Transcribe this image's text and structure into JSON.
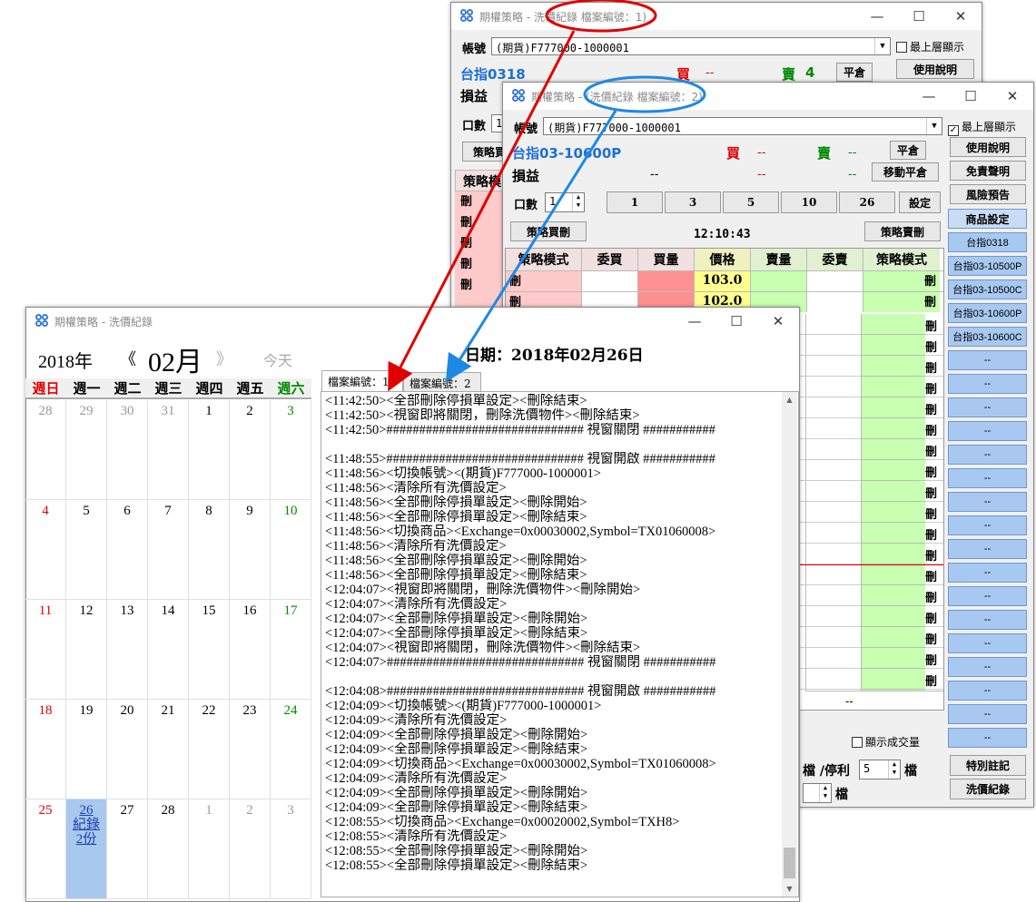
{
  "win1": {
    "title": "期權策略 - 洗價紀錄 檔案編號：1)",
    "account_label": "帳號",
    "account_value": "(期貨)F777000-1000001",
    "topmost_label": "最上層顯示",
    "product": "台指0318",
    "buy_label": "買",
    "buy_value": "--",
    "sell_label": "賣",
    "sell_value": "4",
    "flatten": "平倉",
    "manual": "使用說明",
    "pnl_label": "損益",
    "qty_label": "口數",
    "qty_value": "1",
    "strategy_buy_partial": "策略買",
    "strategy_mode_partial": "策略模",
    "delete_glyph": "刪"
  },
  "win2": {
    "title": "期權策略 - (洗價紀錄 檔案編號：2)",
    "account_label": "帳號",
    "account_value": "(期貨)F777000-1000001",
    "topmost_label": "最上層顯示",
    "product": "台指03-10600P",
    "buy_label": "買",
    "buy_value": "--",
    "sell_label": "賣",
    "sell_value": "--",
    "flatten": "平倉",
    "move_flatten": "移動平倉",
    "pnl_label": "損益",
    "pnl_a": "--",
    "pnl_b": "--",
    "pnl_c": "--",
    "qty_label": "口數",
    "qty_value": "1",
    "qty_buttons": [
      "1",
      "3",
      "5",
      "10",
      "26"
    ],
    "set": "設定",
    "strategy_buy": "策略買刪",
    "time": "12:10:43",
    "strategy_sell": "策略賣刪",
    "headers": [
      "策略模式",
      "委買",
      "買量",
      "價格",
      "賣量",
      "委賣",
      "策略模式"
    ],
    "prices": [
      "103.0",
      "102.0"
    ],
    "delete_glyph": "刪",
    "footer_dash": "--",
    "show_fill_label": "顯示成交量",
    "stop_label": "檔 /停利",
    "stop_value": "5",
    "tick_label": "檔",
    "tick_label2": "檔",
    "side_buttons": [
      "使用說明",
      "免責聲明",
      "風險預告"
    ],
    "product_settings": "商品設定",
    "products": [
      "台指0318",
      "台指03-10500P",
      "台指03-10500C",
      "台指03-10600P",
      "台指03-10600C"
    ],
    "empty_slot": "--",
    "special_note": "特別註記",
    "price_log": "洗價紀錄"
  },
  "win3": {
    "title": "期權策略 - 洗價紀錄",
    "year": "2018年",
    "prev": "《",
    "month": "02月",
    "next": "》",
    "today": "今天",
    "date_label": "日期：2018年02月26日",
    "weekdays": [
      "週日",
      "週一",
      "週二",
      "週三",
      "週四",
      "週五",
      "週六"
    ],
    "days": [
      [
        "28",
        "29",
        "30",
        "31",
        "1",
        "2",
        "3"
      ],
      [
        "4",
        "5",
        "6",
        "7",
        "8",
        "9",
        "10"
      ],
      [
        "11",
        "12",
        "13",
        "14",
        "15",
        "16",
        "17"
      ],
      [
        "18",
        "19",
        "20",
        "21",
        "22",
        "23",
        "24"
      ],
      [
        "25",
        "26",
        "27",
        "28",
        "1",
        "2",
        "3"
      ]
    ],
    "selected_day_note1": "紀錄",
    "selected_day_note2": "2份",
    "tabs": [
      "檔案編號：1",
      "檔案編號：2"
    ],
    "log_lines": [
      "<11:42:50><全部刪除停損單設定><刪除結束>",
      "<11:42:50><視窗即將關閉，刪除洗價物件><刪除結束>",
      "<11:42:50>############################## 視窗關閉 ###########",
      "",
      "<11:48:55>############################## 視窗開啟 ###########",
      "<11:48:56><切換帳號><(期貨)F777000-1000001>",
      "<11:48:56><清除所有洗價設定>",
      "<11:48:56><全部刪除停損單設定><刪除開始>",
      "<11:48:56><全部刪除停損單設定><刪除結束>",
      "<11:48:56><切換商品><Exchange=0x00030002,Symbol=TX01060008>",
      "<11:48:56><清除所有洗價設定>",
      "<11:48:56><全部刪除停損單設定><刪除開始>",
      "<11:48:56><全部刪除停損單設定><刪除結束>",
      "<12:04:07><視窗即將關閉，刪除洗價物件><刪除開始>",
      "<12:04:07><清除所有洗價設定>",
      "<12:04:07><全部刪除停損單設定><刪除開始>",
      "<12:04:07><全部刪除停損單設定><刪除結束>",
      "<12:04:07><視窗即將關閉，刪除洗價物件><刪除結束>",
      "<12:04:07>############################## 視窗關閉 ###########",
      "",
      "<12:04:08>############################## 視窗開啟 ###########",
      "<12:04:09><切換帳號><(期貨)F777000-1000001>",
      "<12:04:09><清除所有洗價設定>",
      "<12:04:09><全部刪除停損單設定><刪除開始>",
      "<12:04:09><全部刪除停損單設定><刪除結束>",
      "<12:04:09><切換商品><Exchange=0x00030002,Symbol=TX01060008>",
      "<12:04:09><清除所有洗價設定>",
      "<12:04:09><全部刪除停損單設定><刪除開始>",
      "<12:04:09><全部刪除停損單設定><刪除結束>",
      "<12:08:55><切換商品><Exchange=0x00020002,Symbol=TXH8>",
      "<12:08:55><清除所有洗價設定>",
      "<12:08:55><全部刪除停損單設定><刪除開始>",
      "<12:08:55><全部刪除停損單設定><刪除結束>"
    ]
  },
  "colors": {
    "accent_blue": "#1e6fd4",
    "buy_red": "#dd0000",
    "sell_green": "#008800",
    "arrow_red": "#e00000",
    "arrow_blue": "#1e88e5",
    "selected_day": "#a8c8ee",
    "bid_cell": "#ffcaca",
    "ask_cell": "#c8ffb0",
    "price_cell": "#ffff90"
  }
}
